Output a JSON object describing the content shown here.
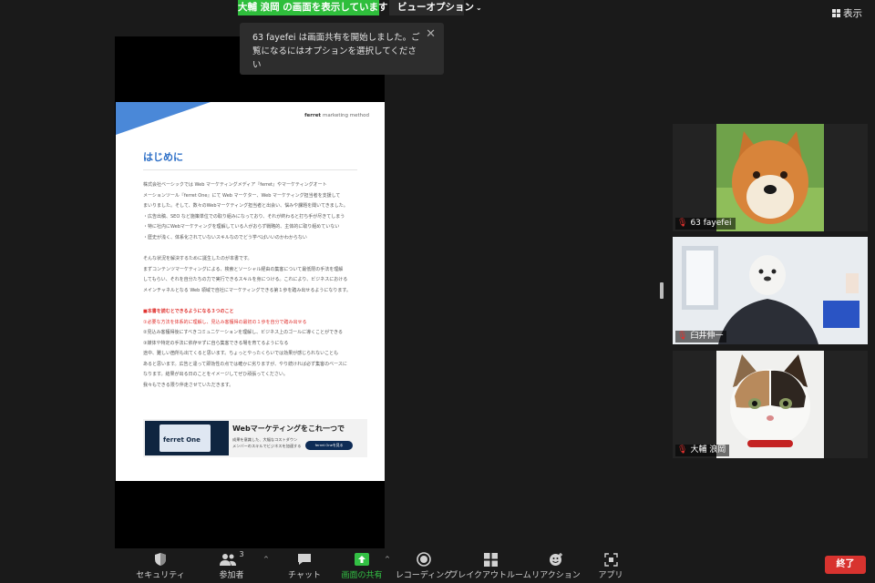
{
  "header": {
    "share_banner": "大輔 浪岡 の画面を表示しています",
    "view_options": "ビューオプション",
    "view_button": "表示"
  },
  "notification": {
    "text": "63 fayefei は画面共有を開始しました。ご覧になるにはオプションを選択してください"
  },
  "document": {
    "logo": "ferret",
    "logo_sub": "marketing method",
    "title": "はじめに",
    "paragraph1": [
      "株式会社ベーシックでは Web マーケティングメディア『ferret』やマーケティングオート",
      "メーションツール『ferret One』にて Web マーケター、Web マーケティング担当者を支援して",
      "まいりました。そして、数々のWebマーケティング担当者と出会い、悩みや課題を聞いてきました。",
      "・広告出稿、SEO など施策単位での取り組みになっており、それが終わると打ち手が尽きてしまう",
      "・特に社内にWebマーケティングを理解している人がおらず戦略的、主体的に取り組めていない",
      "・歴史が浅く、体系化されていないスキルなのでどう学べばいいのかわからない"
    ],
    "paragraph2": [
      "そんな状況を解決するために誕生したのが本書です。",
      "まずコンテンツマーケティングによる、検索とソーシャル経由の集客について最低限の手法を理解",
      "してもらい、それを自分たちの力で実行できるスキルを身につける。これにより、ビジネスにおける",
      "メインチャネルとなる Web 領域で自社にマーケティングできる第１歩を踏み出せるようになります。"
    ],
    "red_heading": "■本書を読むとできるようになる３つのこと",
    "points": [
      "①必要な方法を体系的に理解し、見込み客獲得の最初の１歩を自分で踏み出せる",
      "②見込み客獲得後にすべきコミュニケーションを理解し、ビジネス上のゴールに導くことができる",
      "③媒体や特定の手法に依存せずに自ら集客できる場を育てるようになる"
    ],
    "paragraph3": [
      "途中、難しい箇所も出てくると思います。ちょっとやったくらいでは効果が感じられないことも",
      "あると思います。広告と違って即効性の点では確かに劣りますが、やり続ければ必ず集客のベースに",
      "なります。結果が出る日のことをイメージしてぜひ頑張ってください。",
      "我々もできる限り伴走させていただきます。"
    ],
    "banner": {
      "brand": "ferret One",
      "headline": "Webマーケティングをこれ一つで",
      "sub1": "成果を意識した、大幅なコストダウン",
      "sub2": "メンバーのスキルでビジネスを加速する",
      "cta": "ferret Oneを見る"
    }
  },
  "participants": [
    {
      "name": "63 fayefei",
      "muted": true,
      "active": false,
      "photo": "shiba-dog"
    },
    {
      "name": "臼井伸一",
      "muted": true,
      "active": true,
      "photo": "person-with-seal-mask"
    },
    {
      "name": "大輔 浪岡",
      "muted": true,
      "active": false,
      "photo": "calico-cat"
    }
  ],
  "toolbar": {
    "security": "セキュリティ",
    "participants": "参加者",
    "participants_count": "3",
    "chat": "チャット",
    "share": "画面の共有",
    "record": "レコーディング",
    "breakout": "ブレイクアウトルーム",
    "reactions": "リアクション",
    "apps": "アプリ",
    "end": "終了"
  },
  "colors": {
    "share_green": "#2fbe3c",
    "active_speaker": "#d9e16a",
    "end_red": "#d8332f",
    "doc_accent": "#2d6fc7"
  }
}
